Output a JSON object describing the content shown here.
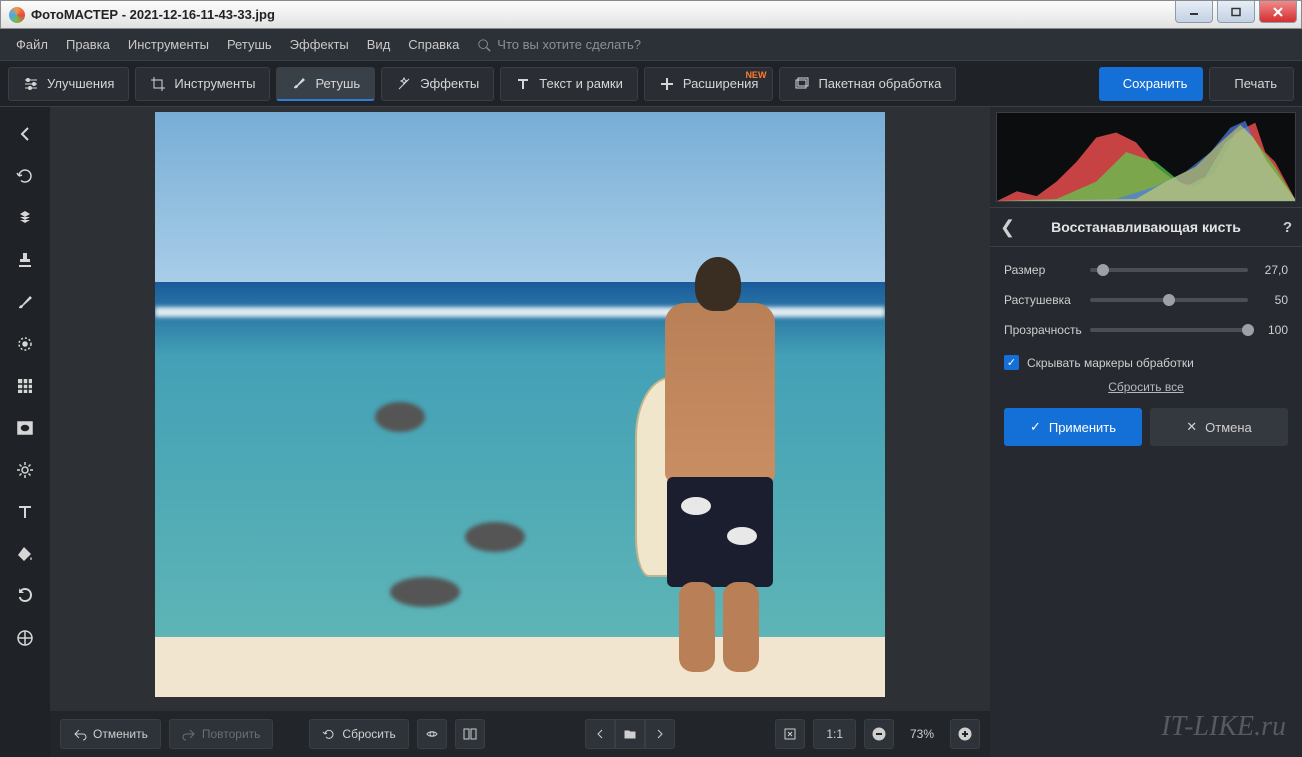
{
  "titlebar": {
    "app": "ФотоМАСТЕР",
    "file": "2021-12-16-11-43-33.jpg"
  },
  "menubar": {
    "items": [
      "Файл",
      "Правка",
      "Инструменты",
      "Ретушь",
      "Эффекты",
      "Вид",
      "Справка"
    ],
    "search_placeholder": "Что вы хотите сделать?"
  },
  "toolbar": {
    "tabs": [
      {
        "label": "Улучшения",
        "icon": "sliders"
      },
      {
        "label": "Инструменты",
        "icon": "crop"
      },
      {
        "label": "Ретушь",
        "icon": "brush",
        "active": true
      },
      {
        "label": "Эффекты",
        "icon": "sparkle"
      },
      {
        "label": "Текст и рамки",
        "icon": "text"
      },
      {
        "label": "Расширения",
        "icon": "plus",
        "badge": "NEW"
      },
      {
        "label": "Пакетная обработка",
        "icon": "batch"
      }
    ],
    "save": "Сохранить",
    "print": "Печать"
  },
  "left_tools": [
    "back-arrow",
    "rotate",
    "healing",
    "stamp",
    "brush",
    "radial",
    "grid",
    "vignette",
    "light",
    "text",
    "fill",
    "replace",
    "3d-lut"
  ],
  "footer": {
    "undo": "Отменить",
    "redo": "Повторить",
    "reset": "Сбросить",
    "zoom_label": "1:1",
    "zoom_value": "73%"
  },
  "right_panel": {
    "title": "Восстанавливающая кисть",
    "sliders": [
      {
        "label": "Размер",
        "value": "27,0",
        "pos": 8
      },
      {
        "label": "Растушевка",
        "value": "50",
        "pos": 50
      },
      {
        "label": "Прозрачность",
        "value": "100",
        "pos": 100
      }
    ],
    "checkbox": "Скрывать маркеры обработки",
    "reset_link": "Сбросить все",
    "apply": "Применить",
    "cancel": "Отмена"
  },
  "watermark": "IT-LIKE.ru"
}
